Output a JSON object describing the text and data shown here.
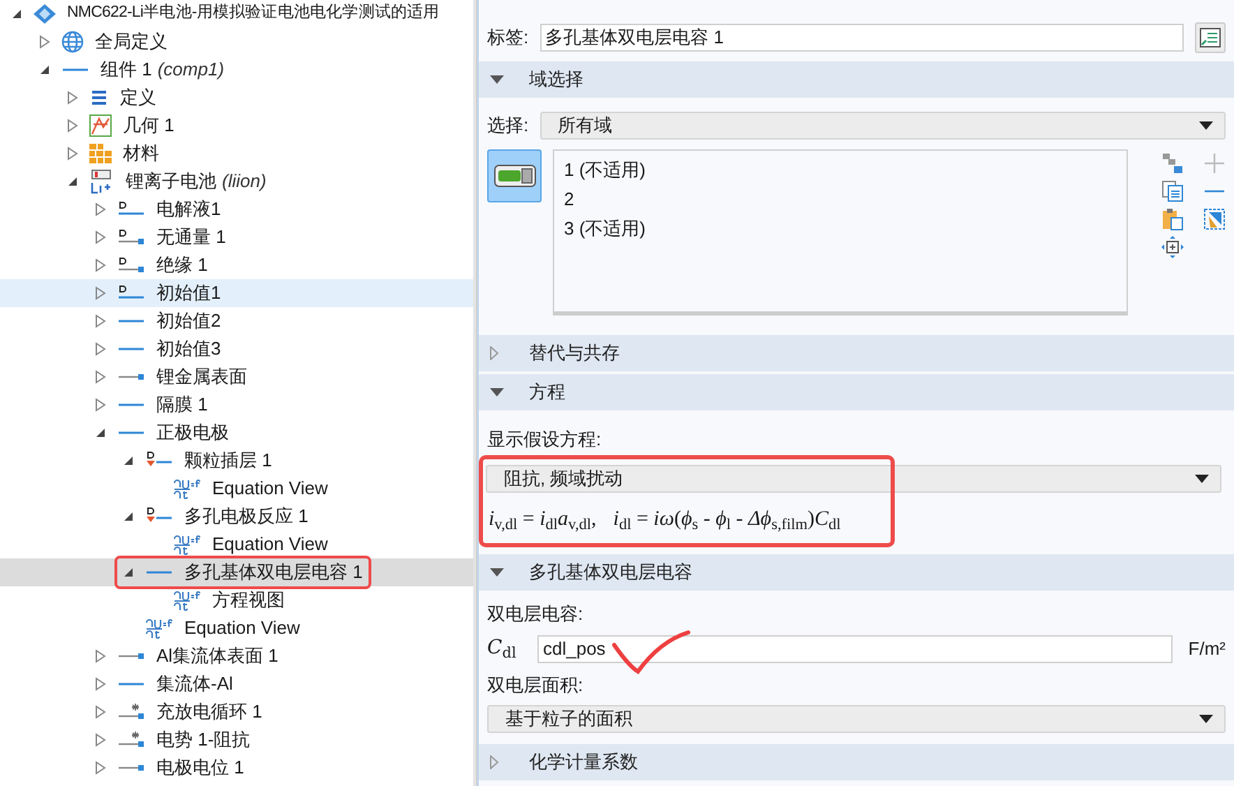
{
  "tree": [
    {
      "label": "NMC622-Li半电池-用模拟验证电池电化学测试的适用",
      "kind": "model",
      "expanded": true,
      "selected": false,
      "highlighted": false,
      "annotated": false,
      "children": [
        {
          "label": "全局定义",
          "kind": "globe",
          "expanded": false,
          "selected": false,
          "highlighted": false,
          "annotated": false
        },
        {
          "label": "组件 1",
          "note": "(comp1)",
          "kind": "line",
          "expanded": true,
          "selected": false,
          "highlighted": false,
          "annotated": false,
          "children": [
            {
              "label": "定义",
              "kind": "definitions",
              "expanded": false,
              "selected": false,
              "highlighted": false,
              "annotated": false
            },
            {
              "label": "几何 1",
              "kind": "geometry",
              "expanded": false,
              "selected": false,
              "highlighted": false,
              "annotated": false
            },
            {
              "label": "材料",
              "kind": "materials",
              "expanded": false,
              "selected": false,
              "highlighted": false,
              "annotated": false
            },
            {
              "label": "锂离子电池",
              "note": "(liion)",
              "kind": "battery",
              "expanded": true,
              "selected": false,
              "highlighted": false,
              "annotated": false,
              "children": [
                {
                  "label": "电解液1",
                  "kind": "d-line",
                  "expanded": false,
                  "selected": false,
                  "highlighted": false,
                  "annotated": false
                },
                {
                  "label": "无通量 1",
                  "kind": "d-boundary",
                  "expanded": false,
                  "selected": false,
                  "highlighted": false,
                  "annotated": false
                },
                {
                  "label": "绝缘 1",
                  "kind": "d-boundary",
                  "expanded": false,
                  "selected": false,
                  "highlighted": false,
                  "annotated": false
                },
                {
                  "label": "初始值1",
                  "kind": "d-line",
                  "expanded": false,
                  "selected": false,
                  "highlighted": true,
                  "annotated": false
                },
                {
                  "label": "初始值2",
                  "kind": "line",
                  "expanded": false,
                  "selected": false,
                  "highlighted": false,
                  "annotated": false
                },
                {
                  "label": "初始值3",
                  "kind": "line",
                  "expanded": false,
                  "selected": false,
                  "highlighted": false,
                  "annotated": false
                },
                {
                  "label": "锂金属表面",
                  "kind": "boundary",
                  "expanded": false,
                  "selected": false,
                  "highlighted": false,
                  "annotated": false
                },
                {
                  "label": "隔膜 1",
                  "kind": "line",
                  "expanded": false,
                  "selected": false,
                  "highlighted": false,
                  "annotated": false
                },
                {
                  "label": "正极电极",
                  "kind": "line",
                  "expanded": true,
                  "selected": false,
                  "highlighted": false,
                  "annotated": false,
                  "children": [
                    {
                      "label": "颗粒插层 1",
                      "kind": "d-red",
                      "expanded": true,
                      "selected": false,
                      "highlighted": false,
                      "annotated": false,
                      "children": [
                        {
                          "label": "Equation View",
                          "kind": "equation",
                          "selected": false,
                          "highlighted": false,
                          "annotated": false
                        }
                      ]
                    },
                    {
                      "label": "多孔电极反应 1",
                      "kind": "d-red",
                      "expanded": true,
                      "selected": false,
                      "highlighted": false,
                      "annotated": false,
                      "children": [
                        {
                          "label": "Equation View",
                          "kind": "equation",
                          "selected": false,
                          "highlighted": false,
                          "annotated": false
                        }
                      ]
                    },
                    {
                      "label": "多孔基体双电层电容 1",
                      "kind": "line",
                      "expanded": true,
                      "selected": true,
                      "highlighted": false,
                      "annotated": true,
                      "children": [
                        {
                          "label": "方程视图",
                          "kind": "equation",
                          "selected": false,
                          "highlighted": false,
                          "annotated": false
                        }
                      ]
                    },
                    {
                      "label": "Equation View",
                      "kind": "equation",
                      "selected": false,
                      "highlighted": false,
                      "annotated": false
                    }
                  ]
                },
                {
                  "label": "Al集流体表面 1",
                  "kind": "boundary",
                  "expanded": false,
                  "selected": false,
                  "highlighted": false,
                  "annotated": false
                },
                {
                  "label": "集流体-Al",
                  "kind": "line",
                  "expanded": false,
                  "selected": false,
                  "highlighted": false,
                  "annotated": false
                },
                {
                  "label": "充放电循环 1",
                  "kind": "star-boundary",
                  "expanded": false,
                  "selected": false,
                  "highlighted": false,
                  "annotated": false
                },
                {
                  "label": "电势 1-阻抗",
                  "kind": "star-boundary",
                  "expanded": false,
                  "selected": false,
                  "highlighted": false,
                  "annotated": false
                },
                {
                  "label": "电极电位 1",
                  "kind": "boundary",
                  "expanded": false,
                  "selected": false,
                  "highlighted": false,
                  "annotated": false
                }
              ]
            }
          ]
        }
      ]
    }
  ],
  "settings": {
    "label_field": {
      "label": "标签:",
      "value": "多孔基体双电层电容 1"
    },
    "sections": [
      {
        "kind": "selection",
        "title": "域选择",
        "expanded": true,
        "select_label": "选择:",
        "select_value": "所有域",
        "active_toggle": true,
        "entries": [
          "1 (不适用)",
          "2",
          "3 (不适用)"
        ]
      },
      {
        "title": "替代与共存",
        "expanded": false
      },
      {
        "kind": "equation",
        "title": "方程",
        "expanded": true,
        "annotated": true,
        "label": "显示假设方程:",
        "select_value": "阻抗, 频域扰动",
        "equations": [
          "*i*$_{v,dl}$ = *i*$_{dl}$*a*$_{v,dl}$,",
          "*i*$_{dl}$ = *iω*(*ϕ*$_{s}$ - *ϕ*$_{l}$ - *Δϕ*$_{s,film}$)*C*$_{dl}$"
        ]
      },
      {
        "kind": "capacitance",
        "title": "多孔基体双电层电容",
        "expanded": true,
        "field_label": "双电层电容:",
        "symbol": "*C*$_{dl}$",
        "value": "cdl_pos",
        "unit": "F/m²",
        "checkmark": true,
        "area_label": "双电层面积:",
        "area_value": "基于粒子的面积"
      },
      {
        "title": "化学计量系数",
        "expanded": false
      }
    ]
  }
}
